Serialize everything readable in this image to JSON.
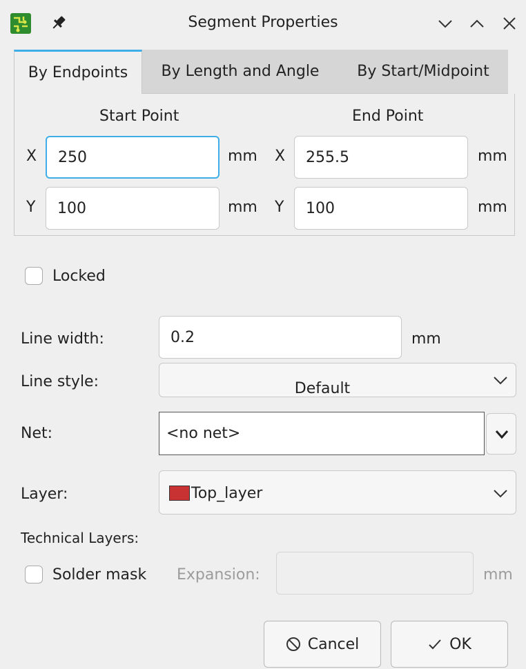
{
  "window": {
    "title": "Segment Properties",
    "app_icon": "kicad-pcb-icon",
    "pin_icon": "pin-icon"
  },
  "tabs": [
    {
      "label": "By Endpoints",
      "active": true
    },
    {
      "label": "By Length and Angle",
      "active": false
    },
    {
      "label": "By Start/Midpoint",
      "active": false
    }
  ],
  "start_point": {
    "heading": "Start Point",
    "x_label": "X",
    "x_value": "250",
    "y_label": "Y",
    "y_value": "100",
    "unit": "mm"
  },
  "end_point": {
    "heading": "End Point",
    "x_label": "X",
    "x_value": "255.5",
    "y_label": "Y",
    "y_value": "100",
    "unit": "mm"
  },
  "locked": {
    "label": "Locked",
    "checked": false
  },
  "line_width": {
    "label": "Line width:",
    "value": "0.2",
    "unit": "mm"
  },
  "line_style": {
    "label": "Line style:",
    "value": "Default"
  },
  "net": {
    "label": "Net:",
    "value": "<no net>"
  },
  "layer": {
    "label": "Layer:",
    "value": "Top_layer",
    "swatch_color": "#c83232"
  },
  "technical_layers": {
    "heading": "Technical Layers:",
    "solder_mask_label": "Solder mask",
    "solder_mask_checked": false,
    "expansion_label": "Expansion:",
    "expansion_value": "",
    "expansion_unit": "mm"
  },
  "buttons": {
    "cancel": "Cancel",
    "ok": "OK"
  },
  "colors": {
    "accent": "#3daee9",
    "background": "#efefef"
  }
}
